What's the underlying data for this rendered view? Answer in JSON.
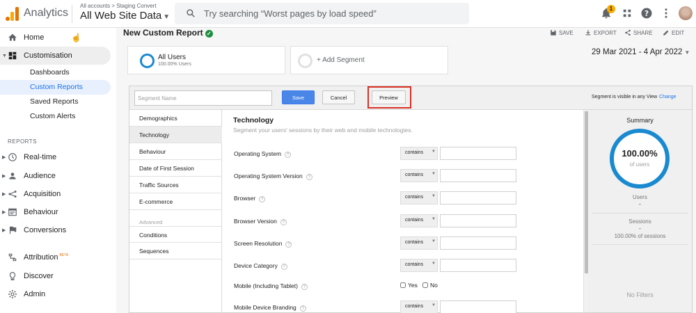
{
  "topbar": {
    "app_title": "Analytics",
    "breadcrumb": "All accounts > Staging Convert",
    "account": "All Web Site Data",
    "search_placeholder": "Try searching “Worst pages by load speed”",
    "notification_count": "1",
    "brand_color": "#f9ab00"
  },
  "sidebar": {
    "home": "Home",
    "customisation": "Customisation",
    "sub_items": [
      "Dashboards",
      "Custom Reports",
      "Saved Reports",
      "Custom Alerts"
    ],
    "reports_label": "REPORTS",
    "report_items": [
      "Real-time",
      "Audience",
      "Acquisition",
      "Behaviour",
      "Conversions"
    ],
    "attribution": "Attribution",
    "beta": "BETA",
    "discover": "Discover",
    "admin": "Admin"
  },
  "header": {
    "title": "New Custom Report",
    "actions": [
      "SAVE",
      "EXPORT",
      "SHARE",
      "EDIT"
    ]
  },
  "segments": {
    "all_users": "All Users",
    "all_users_pct": "100.00% Users",
    "add_segment": "+ Add Segment",
    "date_range": "29 Mar 2021 - 4 Apr 2022"
  },
  "editor": {
    "segment_name_placeholder": "Segment Name",
    "save": "Save",
    "cancel": "Cancel",
    "preview": "Preview",
    "visibility": "Segment is visible in any View",
    "change": "Change",
    "categories": [
      "Demographics",
      "Technology",
      "Behaviour",
      "Date of First Session",
      "Traffic Sources",
      "E-commerce"
    ],
    "advanced_label": "Advanced",
    "advanced": [
      "Conditions",
      "Sequences"
    ],
    "tech_title": "Technology",
    "tech_subtitle": "Segment your users' sessions by their web and mobile technologies.",
    "fields": [
      "Operating System",
      "Operating System Version",
      "Browser",
      "Browser Version",
      "Screen Resolution",
      "Device Category",
      "Mobile (Including Tablet)",
      "Mobile Device Branding"
    ],
    "operator": "contains",
    "yes": "Yes",
    "no": "No"
  },
  "summary": {
    "title": "Summary",
    "percent": "100.00%",
    "of_users": "of users",
    "users_label": "Users",
    "users_value": "-",
    "sessions_label": "Sessions",
    "sessions_value": "-",
    "sessions_pct": "100.00% of sessions",
    "no_filters": "No Filters",
    "ring_color": "#1a8ad0"
  }
}
